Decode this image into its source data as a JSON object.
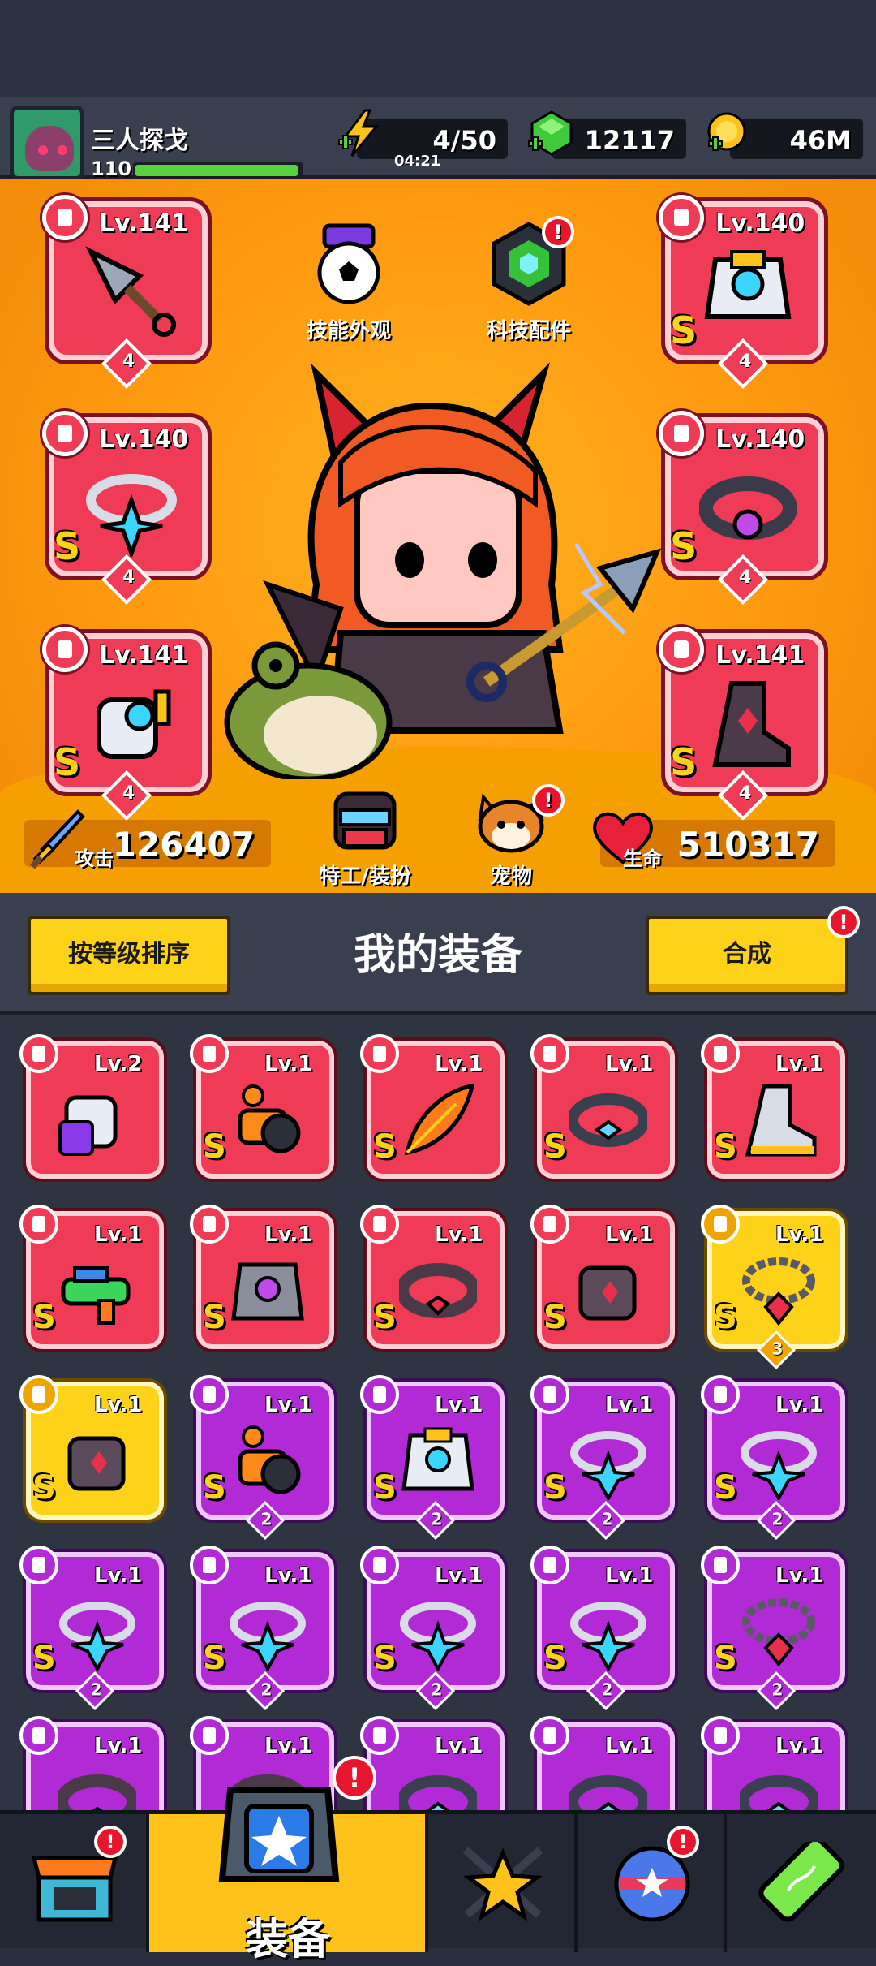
{
  "player": {
    "name": "三人探戈",
    "level": "110",
    "xp_fraction": 0.98
  },
  "resources": {
    "energy": "4/50",
    "energy_timer": "04:21",
    "gems": "12117",
    "gold": "46M"
  },
  "stage": {
    "skin_button": "技能外观",
    "tech_button": "科技配件",
    "agent_button": "特工/装扮",
    "pet_button": "宠物",
    "attack_label": "攻击",
    "attack_value": "126407",
    "hp_label": "生命",
    "hp_value": "510317",
    "alert": "!"
  },
  "equipped": [
    {
      "slot": "weapon",
      "level": "Lv.141",
      "stars": "4",
      "rank": ""
    },
    {
      "slot": "armor",
      "level": "Lv.140",
      "stars": "4",
      "rank": "S"
    },
    {
      "slot": "necklace",
      "level": "Lv.140",
      "stars": "4",
      "rank": "S"
    },
    {
      "slot": "belt",
      "level": "Lv.140",
      "stars": "4",
      "rank": "S"
    },
    {
      "slot": "gloves",
      "level": "Lv.141",
      "stars": "4",
      "rank": "S"
    },
    {
      "slot": "boots",
      "level": "Lv.141",
      "stars": "4",
      "rank": "S"
    }
  ],
  "panel": {
    "sort_button": "按等级排序",
    "title": "我的装备",
    "merge_button": "合成",
    "alert": "!"
  },
  "inventory": [
    {
      "level": "Lv.2",
      "rank": "",
      "count": "",
      "rarity": "red",
      "art": "gauntlet-purple"
    },
    {
      "level": "Lv.1",
      "rank": "S",
      "count": "",
      "rarity": "red",
      "art": "turret"
    },
    {
      "level": "Lv.1",
      "rank": "S",
      "count": "",
      "rarity": "red",
      "art": "feather"
    },
    {
      "level": "Lv.1",
      "rank": "S",
      "count": "",
      "rarity": "red",
      "art": "belt"
    },
    {
      "level": "Lv.1",
      "rank": "S",
      "count": "",
      "rarity": "red",
      "art": "boot"
    },
    {
      "level": "Lv.1",
      "rank": "S",
      "count": "",
      "rarity": "red",
      "art": "water-gun"
    },
    {
      "level": "Lv.1",
      "rank": "S",
      "count": "",
      "rarity": "red",
      "art": "armor"
    },
    {
      "level": "Lv.1",
      "rank": "S",
      "count": "",
      "rarity": "red",
      "art": "belt-dark"
    },
    {
      "level": "Lv.1",
      "rank": "S",
      "count": "",
      "rarity": "red",
      "art": "gauntlet"
    },
    {
      "level": "Lv.1",
      "rank": "S",
      "count": "3",
      "rarity": "gold",
      "art": "chain-necklace"
    },
    {
      "level": "Lv.1",
      "rank": "S",
      "count": "",
      "rarity": "gold",
      "art": "gauntlet"
    },
    {
      "level": "Lv.1",
      "rank": "S",
      "count": "2",
      "rarity": "purple",
      "art": "turret"
    },
    {
      "level": "Lv.1",
      "rank": "S",
      "count": "2",
      "rarity": "purple",
      "art": "armor-cyan"
    },
    {
      "level": "Lv.1",
      "rank": "S",
      "count": "2",
      "rarity": "purple",
      "art": "star-necklace"
    },
    {
      "level": "Lv.1",
      "rank": "S",
      "count": "2",
      "rarity": "purple",
      "art": "star-necklace"
    },
    {
      "level": "Lv.1",
      "rank": "S",
      "count": "2",
      "rarity": "purple",
      "art": "star-necklace"
    },
    {
      "level": "Lv.1",
      "rank": "S",
      "count": "2",
      "rarity": "purple",
      "art": "star-necklace"
    },
    {
      "level": "Lv.1",
      "rank": "S",
      "count": "2",
      "rarity": "purple",
      "art": "star-necklace"
    },
    {
      "level": "Lv.1",
      "rank": "S",
      "count": "2",
      "rarity": "purple",
      "art": "star-necklace"
    },
    {
      "level": "Lv.1",
      "rank": "S",
      "count": "2",
      "rarity": "purple",
      "art": "chain-necklace"
    },
    {
      "level": "Lv.1",
      "rank": "",
      "count": "",
      "rarity": "purple",
      "art": "belt-dark"
    },
    {
      "level": "Lv.1",
      "rank": "",
      "count": "",
      "rarity": "purple",
      "art": "belt-dark"
    },
    {
      "level": "Lv.1",
      "rank": "",
      "count": "",
      "rarity": "purple",
      "art": "belt"
    },
    {
      "level": "Lv.1",
      "rank": "",
      "count": "",
      "rarity": "purple",
      "art": "belt"
    },
    {
      "level": "Lv.1",
      "rank": "",
      "count": "",
      "rarity": "purple",
      "art": "belt"
    }
  ],
  "nav": {
    "active_label": "装备",
    "alert": "!"
  },
  "colors": {
    "red": "#ef3b55",
    "purple": "#b12ad6",
    "gold": "#ffd21a",
    "stage": "#ff9a10"
  }
}
